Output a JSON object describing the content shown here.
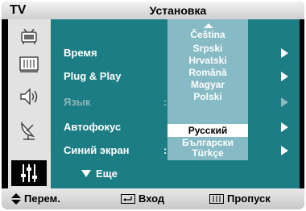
{
  "header": {
    "tv_label": "TV",
    "title": "Установка"
  },
  "sidebar": {
    "icons": [
      "tv-antenna-icon",
      "picture-grid-icon",
      "speaker-icon",
      "satellite-dish-icon",
      "settings-sliders-icon"
    ],
    "active_index": 4
  },
  "menu": {
    "items": [
      {
        "label": "Время",
        "enabled": true,
        "has_colon": false,
        "has_arrow": true
      },
      {
        "label": "Plug & Play",
        "enabled": true,
        "has_colon": false,
        "has_arrow": true
      },
      {
        "label": "Язык",
        "enabled": false,
        "has_colon": true,
        "has_arrow": true
      },
      {
        "label": "Автофокус",
        "enabled": true,
        "has_colon": false,
        "has_arrow": true
      },
      {
        "label": "Синий экран",
        "enabled": true,
        "has_colon": true,
        "has_arrow": true
      }
    ],
    "more_label": "Еще"
  },
  "language_dropdown": {
    "options": [
      "Čeština",
      "Srpski",
      "Hrvatski",
      "Română",
      "Magyar",
      "Polski",
      "Русский",
      "Български",
      "Türkçe"
    ],
    "selected": "Русский"
  },
  "footer": {
    "move_label": "Перем.",
    "enter_label": "Вход",
    "skip_label": "Пропуск"
  },
  "colors": {
    "menu_bg": "#1c7d84",
    "dropdown_bg": "#86bac5",
    "sidebar_bg": "#e2e2e2"
  }
}
